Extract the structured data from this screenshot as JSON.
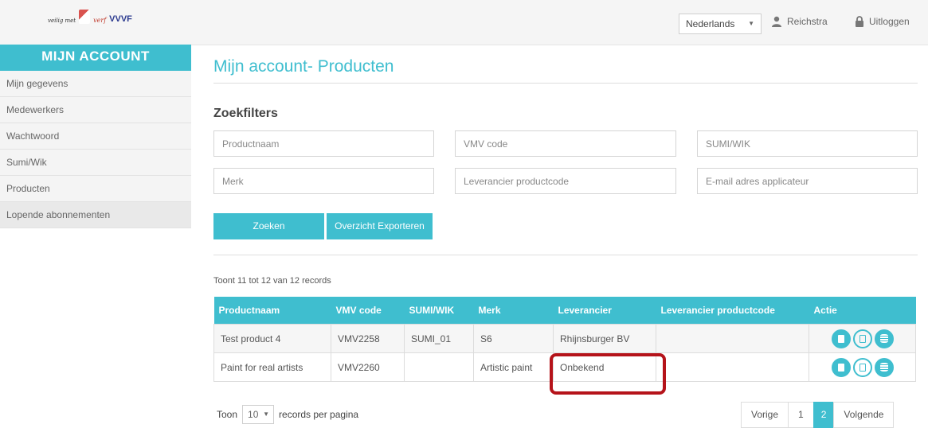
{
  "header": {
    "logo_text_1": "veilig met",
    "logo_text_2": "verf",
    "logo_text_3": "VVVF",
    "language": "Nederlands",
    "user_name": "Reichstra",
    "logout_label": "Uitloggen"
  },
  "sidebar": {
    "title": "MIJN ACCOUNT",
    "items": [
      {
        "label": "Mijn gegevens"
      },
      {
        "label": "Medewerkers"
      },
      {
        "label": "Wachtwoord"
      },
      {
        "label": "Sumi/Wik"
      },
      {
        "label": "Producten"
      },
      {
        "label": "Lopende abonnementen"
      }
    ]
  },
  "main": {
    "title": "Mijn account- Producten",
    "filters_title": "Zoekfilters",
    "filters": {
      "product_name": "Productnaam",
      "vmv_code": "VMV code",
      "sumi_wik": "SUMI/WIK",
      "brand": "Merk",
      "supplier_code": "Leverancier productcode",
      "applicator_email": "E-mail adres applicateur"
    },
    "search_button": "Zoeken",
    "export_button": "Overzicht Exporteren",
    "records_info": "Toont 11 tot 12 van 12 records"
  },
  "table": {
    "headers": [
      "Productnaam",
      "VMV code",
      "SUMI/WIK",
      "Merk",
      "Leverancier",
      "Leverancier productcode",
      "Actie"
    ],
    "rows": [
      {
        "name": "Test product 4",
        "vmv": "VMV2258",
        "sumi": "SUMI_01",
        "brand": "S6",
        "supplier": "Rhijnsburger BV",
        "supplier_code": ""
      },
      {
        "name": "Paint for real artists",
        "vmv": "VMV2260",
        "sumi": "",
        "brand": "Artistic paint",
        "supplier": "Onbekend",
        "supplier_code": ""
      }
    ]
  },
  "pagination": {
    "show_label": "Toon",
    "per_page": "10",
    "per_page_suffix": "records per pagina",
    "prev": "Vorige",
    "pages": [
      "1",
      "2"
    ],
    "current_page": "2",
    "next": "Volgende"
  },
  "colors": {
    "accent": "#3fbecf",
    "highlight": "#b5131a"
  }
}
